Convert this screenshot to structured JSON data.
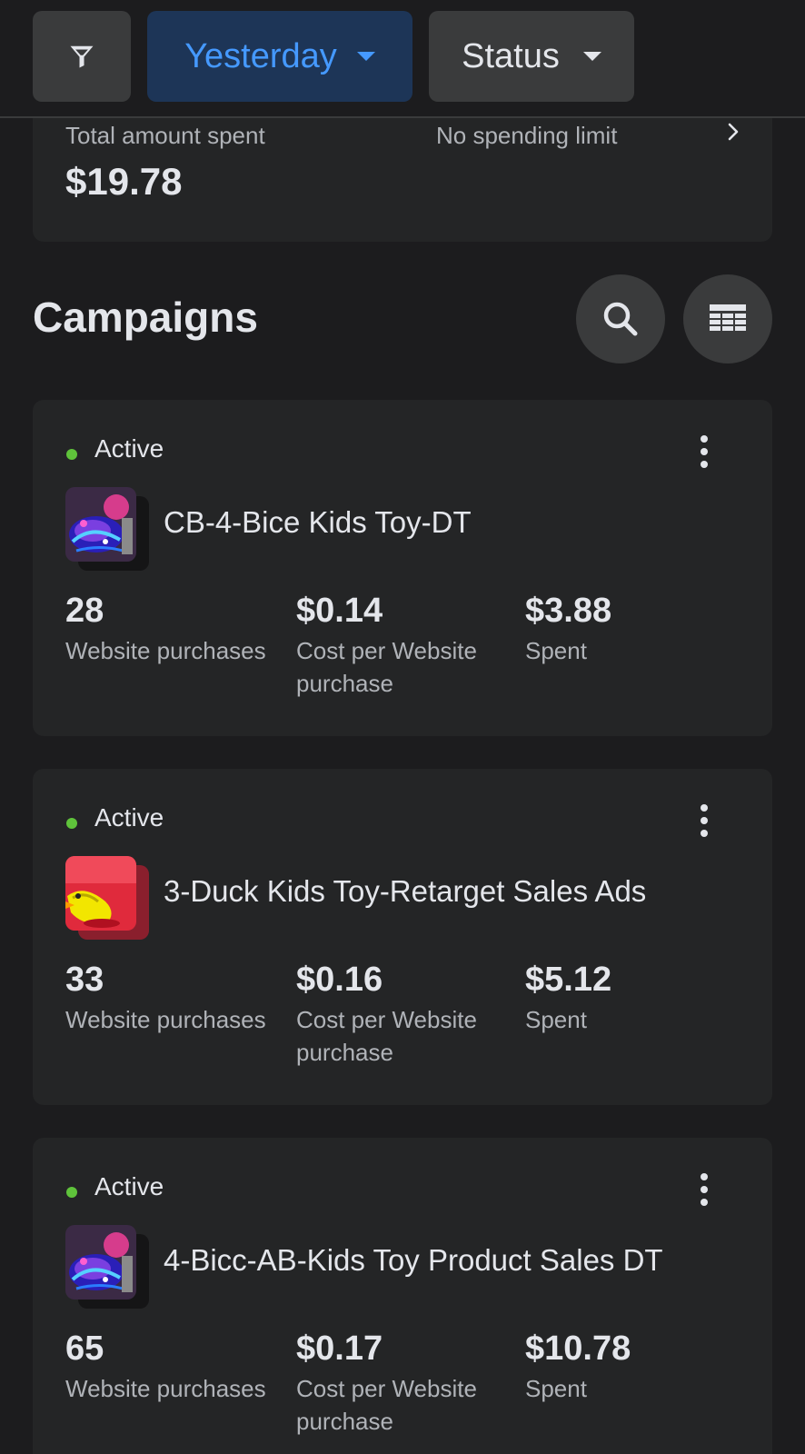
{
  "filters": {
    "date_label": "Yesterday",
    "status_label": "Status",
    "icons": {
      "filter": "filter-funnel-icon",
      "dropdown": "caret-down-icon"
    },
    "colors": {
      "date_text": "#4599ff",
      "date_bg": "#1d3557"
    }
  },
  "summary": {
    "total_label": "Total amount spent",
    "total_value": "$19.78",
    "limit_label": "No spending limit"
  },
  "campaigns_section": {
    "title": "Campaigns",
    "icons": {
      "search": "search-icon",
      "columns": "table-columns-icon"
    }
  },
  "campaigns": [
    {
      "status": "Active",
      "status_color": "#5fc33b",
      "name": "CB-4-Bice Kids Toy-DT",
      "thumbnail": "toy-light-thumbnail",
      "metrics": [
        {
          "value": "28",
          "label": "Website purchases"
        },
        {
          "value": "$0.14",
          "label": "Cost per Website purchase"
        },
        {
          "value": "$3.88",
          "label": "Spent"
        }
      ]
    },
    {
      "status": "Active",
      "status_color": "#5fc33b",
      "name": "3-Duck Kids Toy-Retarget Sales Ads",
      "thumbnail": "duck-toy-thumbnail",
      "metrics": [
        {
          "value": "33",
          "label": "Website purchases"
        },
        {
          "value": "$0.16",
          "label": "Cost per Website purchase"
        },
        {
          "value": "$5.12",
          "label": "Spent"
        }
      ]
    },
    {
      "status": "Active",
      "status_color": "#5fc33b",
      "name": "4-Bicc-AB-Kids Toy Product Sales DT",
      "thumbnail": "toy-light-thumbnail",
      "metrics": [
        {
          "value": "65",
          "label": "Website purchases"
        },
        {
          "value": "$0.17",
          "label": "Cost per Website purchase"
        },
        {
          "value": "$10.78",
          "label": "Spent"
        }
      ]
    }
  ]
}
